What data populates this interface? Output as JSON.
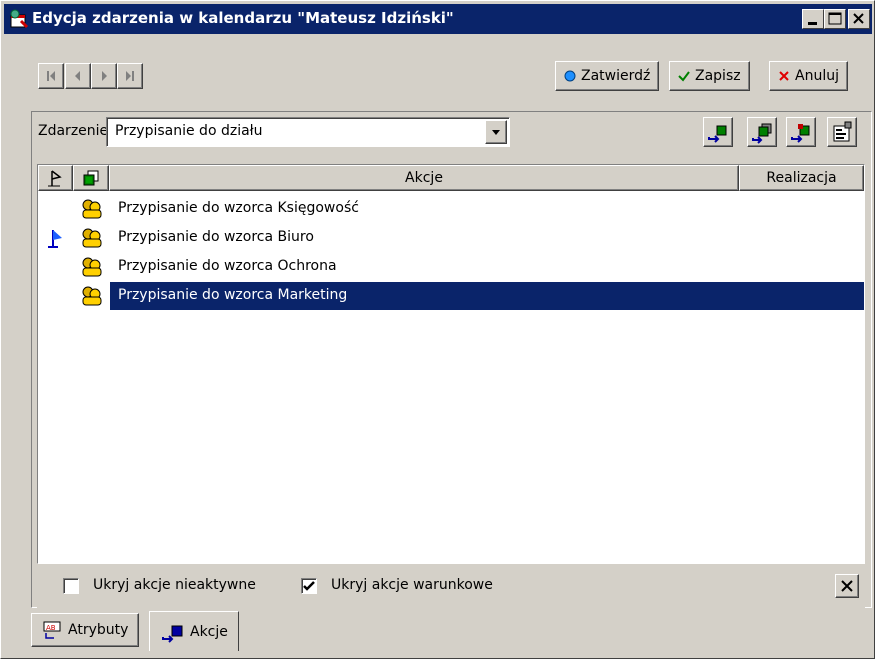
{
  "window": {
    "title": "Edycja zdarzenia w kalendarzu \"Mateusz Idziński\""
  },
  "toolbar": {
    "confirm_label": "Zatwierdź",
    "save_label": "Zapisz",
    "cancel_label": "Anuluj"
  },
  "event": {
    "label": "Zdarzenie:",
    "value": "Przypisanie do działu"
  },
  "table": {
    "columns": [
      "Akcje",
      "Realizacja"
    ],
    "rows": [
      {
        "label": "Przypisanie do wzorca Księgowość",
        "flag": false,
        "selected": false
      },
      {
        "label": "Przypisanie do wzorca Biuro",
        "flag": true,
        "selected": false
      },
      {
        "label": "Przypisanie do wzorca Ochrona",
        "flag": false,
        "selected": false
      },
      {
        "label": "Przypisanie do wzorca Marketing",
        "flag": false,
        "selected": true
      }
    ]
  },
  "options": {
    "hide_inactive_label": "Ukryj akcje nieaktywne",
    "hide_inactive_checked": false,
    "hide_conditional_label": "Ukryj akcje warunkowe",
    "hide_conditional_checked": true
  },
  "tabs": [
    {
      "label": "Atrybuty",
      "active": false
    },
    {
      "label": "Akcje",
      "active": true
    }
  ],
  "colors": {
    "titlebar": "#0a246a",
    "selection": "#0a246a",
    "face": "#d4d0c8"
  }
}
